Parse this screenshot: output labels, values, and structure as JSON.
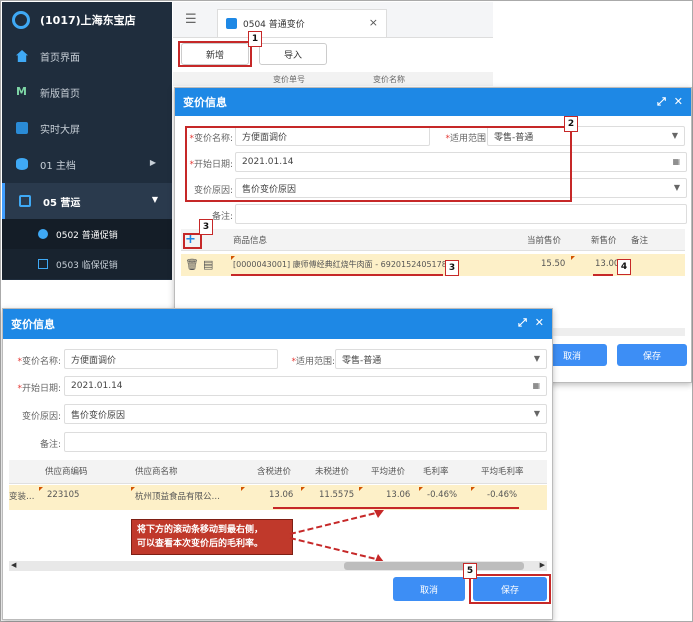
{
  "app": {
    "store_name": "(1017)上海东宝店"
  },
  "sidebar": {
    "items": [
      {
        "label": "首页界面",
        "icon": "home-icon"
      },
      {
        "label": "新版首页",
        "icon": "m-logo-icon"
      },
      {
        "label": "实时大屏",
        "icon": "screen-icon"
      },
      {
        "label": "01 主档",
        "icon": "database-icon"
      },
      {
        "label": "05 营运",
        "icon": "monitor-icon"
      }
    ],
    "sub_items": [
      {
        "label": "0502 普通促销",
        "icon": "percent-icon"
      },
      {
        "label": "0503 临保促销",
        "icon": "tag-icon"
      }
    ]
  },
  "tab": {
    "title": "0504 普通变价",
    "close": "×"
  },
  "toolbar": {
    "new_label": "新增",
    "import_label": "导入"
  },
  "list_header": {
    "col1": "变价单号",
    "col2": "变价名称"
  },
  "modal_back": {
    "title": "变价信息",
    "name_label": "变价名称:",
    "name_value": "方便面调价",
    "scope_label": "适用范围:",
    "scope_value": "零售-普通",
    "date_label": "开始日期:",
    "date_value": "2021.01.14",
    "reason_label": "变价原因:",
    "reason_value": "售价变价原因",
    "remark_label": "备注:",
    "cols": {
      "product": "商品信息",
      "cur_price": "当前售价",
      "new_price": "新售价",
      "remark": "备注"
    },
    "row": {
      "product": "[0000043001] 康师傅经典红烧牛肉面 - 6920152405178",
      "cur_price": "15.50",
      "new_price": "13.00"
    },
    "cancel": "取消",
    "save": "保存"
  },
  "modal_front": {
    "title": "变价信息",
    "name_label": "变价名称:",
    "name_value": "方便面调价",
    "scope_label": "适用范围:",
    "scope_value": "零售-普通",
    "date_label": "开始日期:",
    "date_value": "2021.01.14",
    "reason_label": "变价原因:",
    "reason_value": "售价变价原因",
    "remark_label": "备注:",
    "cols": {
      "supplier_code": "供应商编码",
      "supplier_name": "供应商名称",
      "tax_price": "含税进价",
      "notax_price": "未税进价",
      "avg_price": "平均进价",
      "margin": "毛利率",
      "avg_margin": "平均毛利率"
    },
    "row": {
      "prefix": "变装…",
      "supplier_code": "223105",
      "supplier_name": "杭州顶益食品有限公…",
      "tax_price": "13.06",
      "notax_price": "11.5575",
      "avg_price": "13.06",
      "margin": "-0.46%",
      "avg_margin": "-0.46%"
    },
    "cancel": "取消",
    "save": "保存"
  },
  "callout": {
    "line1": "将下方的滚动条移动到最右侧，",
    "line2": "可以查看本次变价后的毛利率。"
  },
  "markers": [
    "1",
    "2",
    "3",
    "3",
    "4",
    "5"
  ],
  "colors": {
    "accent": "#1e88e5",
    "sidebar": "#1f2d3d",
    "highlight_row": "#fdf0c8",
    "annotation": "#c62828"
  }
}
